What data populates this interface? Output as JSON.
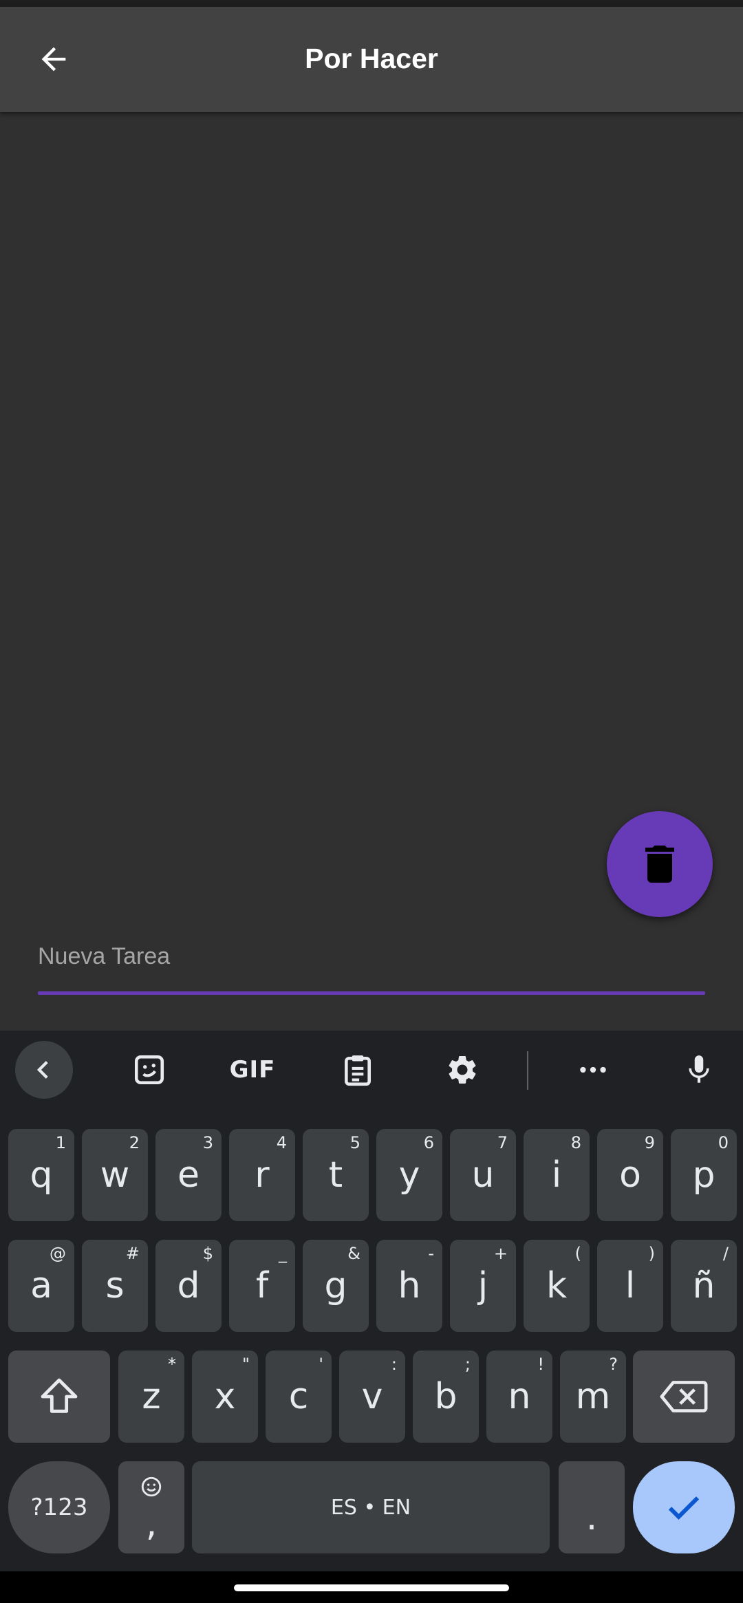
{
  "appbar": {
    "title": "Por Hacer"
  },
  "input": {
    "placeholder": "Nueva Tarea",
    "value": ""
  },
  "colors": {
    "accent": "#673ab7",
    "appbar": "#424242",
    "background": "#303030",
    "enter_key": "#a8c7fa"
  },
  "keyboard": {
    "toolbar": {
      "gif_label": "GIF"
    },
    "rows": [
      [
        {
          "m": "q",
          "s": "1"
        },
        {
          "m": "w",
          "s": "2"
        },
        {
          "m": "e",
          "s": "3"
        },
        {
          "m": "r",
          "s": "4"
        },
        {
          "m": "t",
          "s": "5"
        },
        {
          "m": "y",
          "s": "6"
        },
        {
          "m": "u",
          "s": "7"
        },
        {
          "m": "i",
          "s": "8"
        },
        {
          "m": "o",
          "s": "9"
        },
        {
          "m": "p",
          "s": "0"
        }
      ],
      [
        {
          "m": "a",
          "s": "@"
        },
        {
          "m": "s",
          "s": "#"
        },
        {
          "m": "d",
          "s": "$"
        },
        {
          "m": "f",
          "s": "_"
        },
        {
          "m": "g",
          "s": "&"
        },
        {
          "m": "h",
          "s": "-"
        },
        {
          "m": "j",
          "s": "+"
        },
        {
          "m": "k",
          "s": "("
        },
        {
          "m": "l",
          "s": ")"
        },
        {
          "m": "ñ",
          "s": "/"
        }
      ],
      [
        {
          "m": "z",
          "s": "*"
        },
        {
          "m": "x",
          "s": "\""
        },
        {
          "m": "c",
          "s": "'"
        },
        {
          "m": "v",
          "s": ":"
        },
        {
          "m": "b",
          "s": ";"
        },
        {
          "m": "n",
          "s": "!"
        },
        {
          "m": "m",
          "s": "?"
        }
      ]
    ],
    "symbols_label": "?123",
    "comma_label": ",",
    "space_label": "ES • EN",
    "period_label": "."
  }
}
